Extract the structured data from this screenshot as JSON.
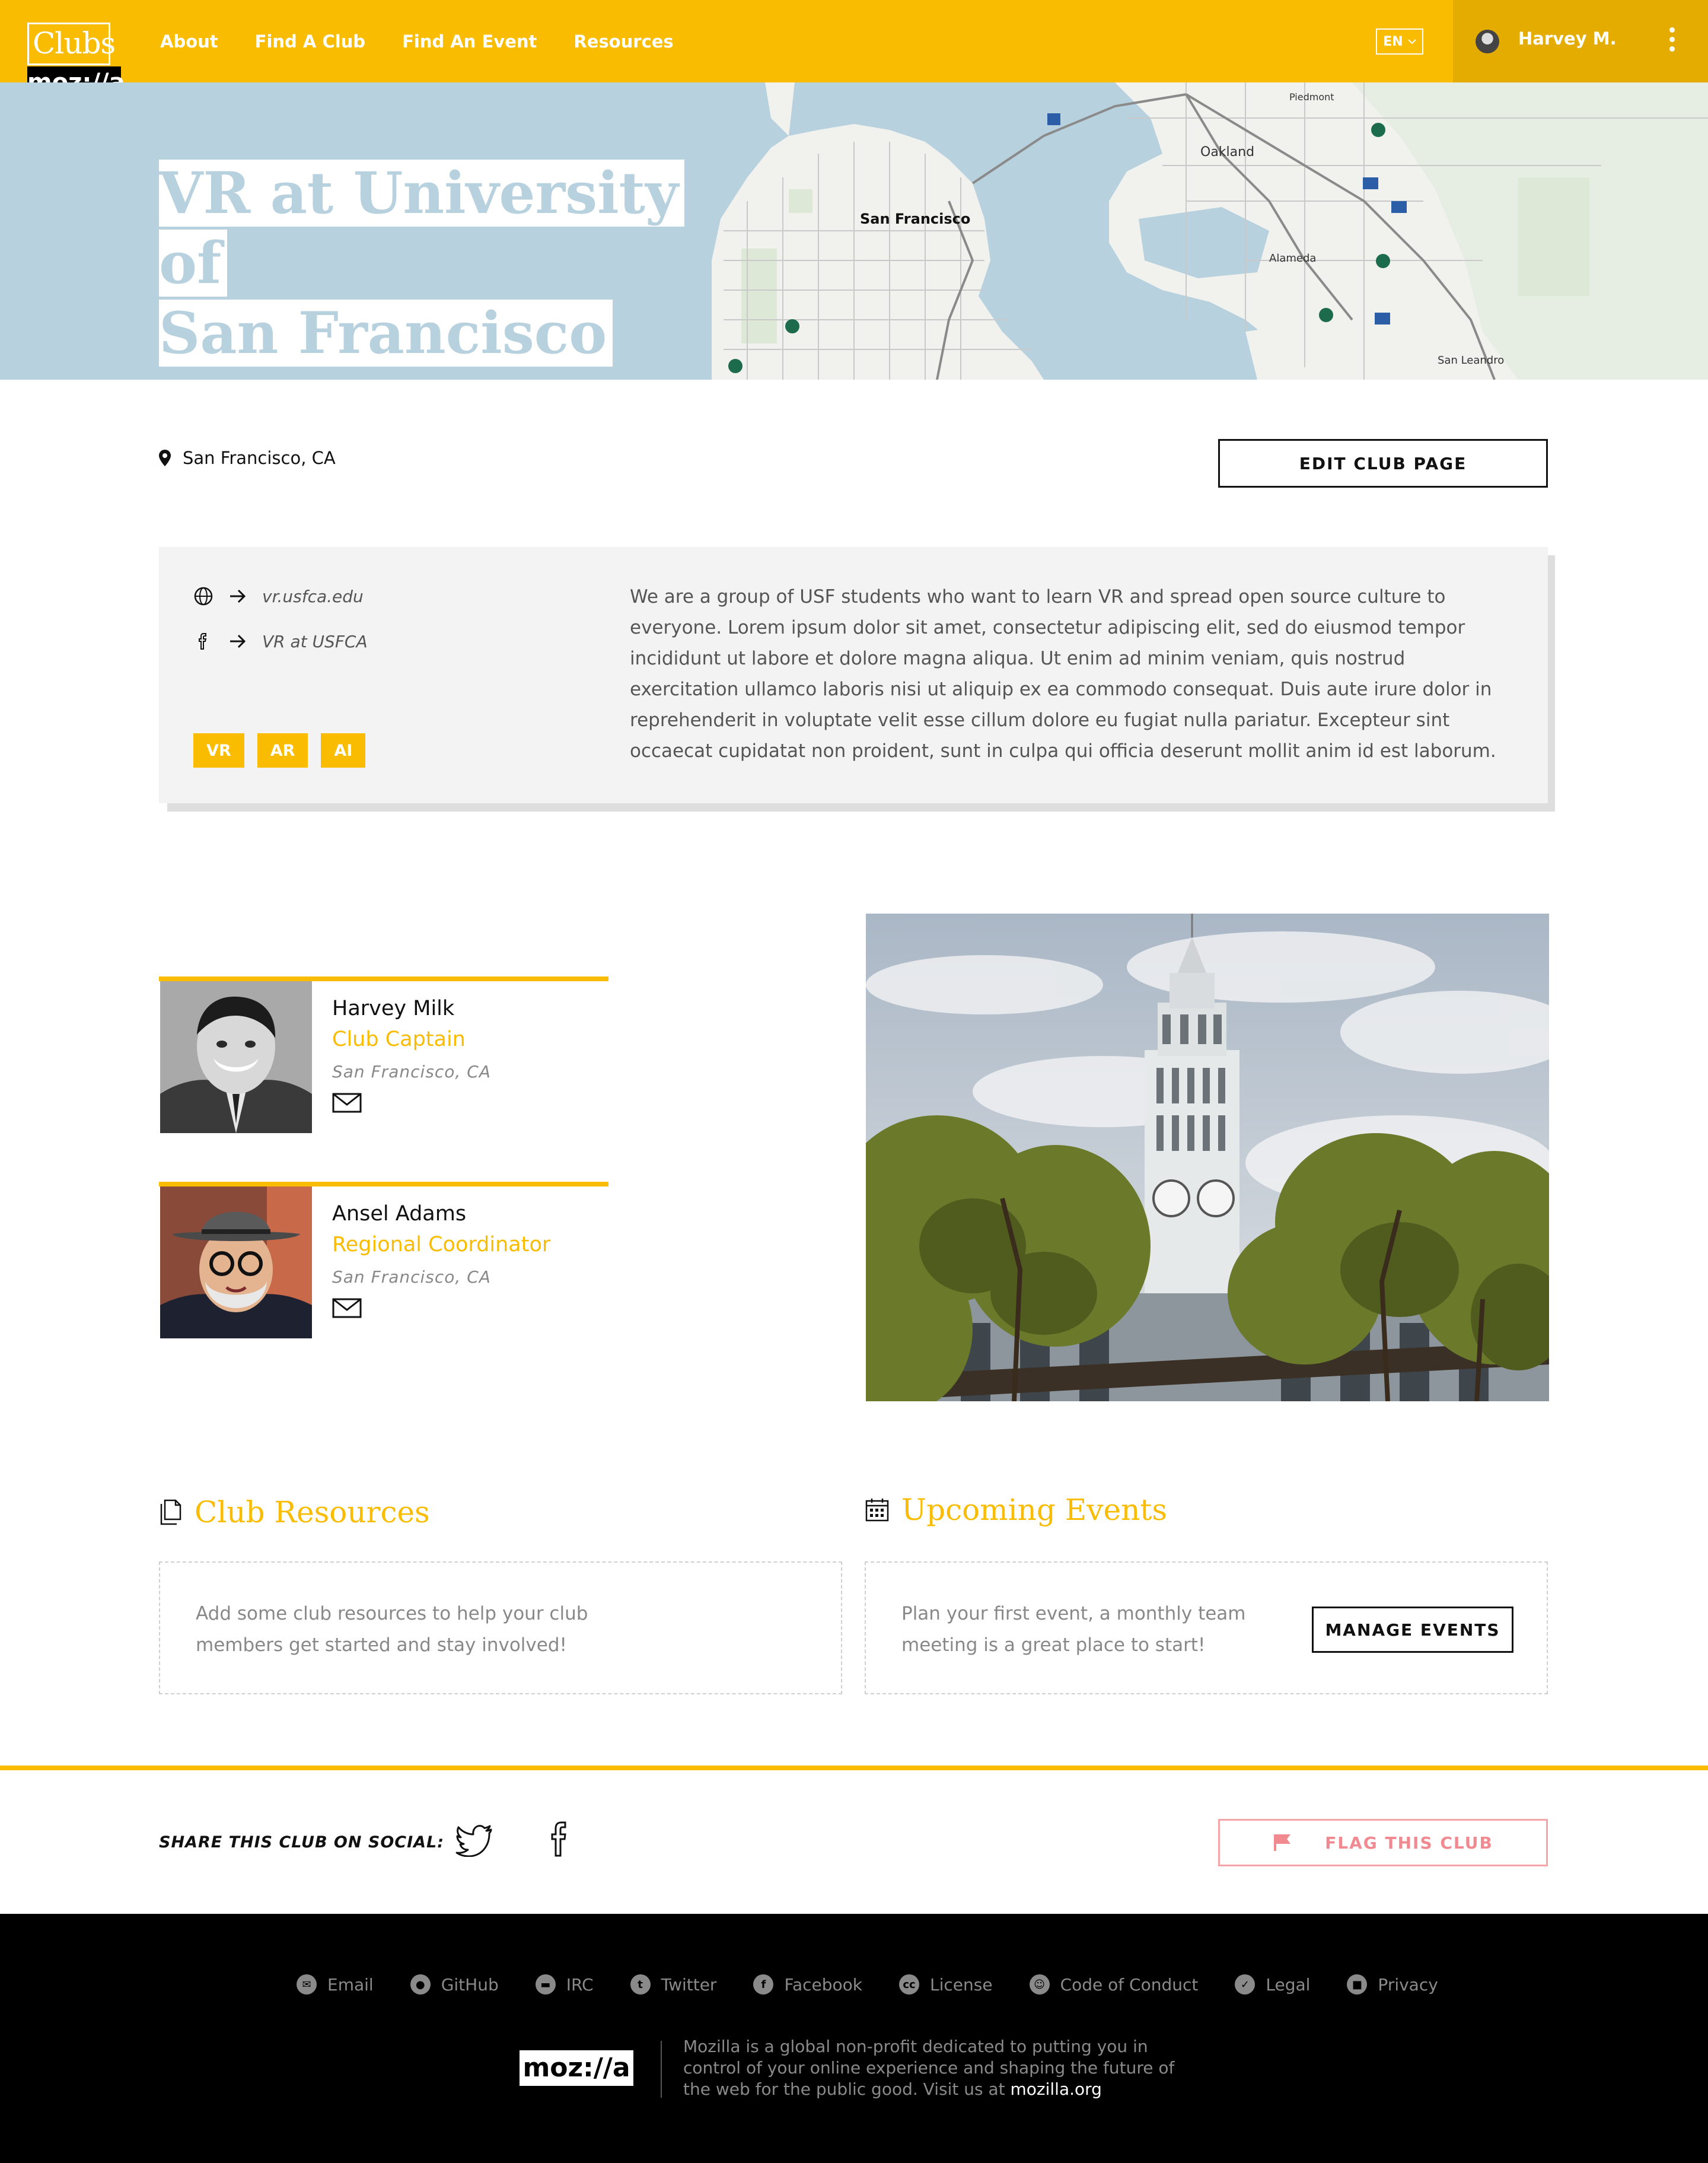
{
  "header": {
    "logo_clubs": "Clubs",
    "logo_mozilla": "moz://a",
    "nav": [
      {
        "label": "About"
      },
      {
        "label": "Find A Club"
      },
      {
        "label": "Find An Event"
      },
      {
        "label": "Resources"
      }
    ],
    "language": "EN",
    "user_name": "Harvey M."
  },
  "hero": {
    "title_line1": "VR at University of",
    "title_line2": "San Francisco",
    "map_labels": [
      "San Francisco",
      "Oakland",
      "Alameda",
      "Piedmont",
      "San Leandro"
    ]
  },
  "club": {
    "location": "San Francisco, CA",
    "edit_label": "EDIT CLUB PAGE",
    "website": "vr.usfca.edu",
    "facebook": "VR at USFCA",
    "tags": [
      "VR",
      "AR",
      "AI"
    ],
    "description": "We are a group of USF students who want to learn VR and spread open source culture to everyone. Lorem ipsum dolor sit amet, consectetur adipiscing elit, sed do eiusmod tempor incididunt ut labore et dolore magna aliqua. Ut enim ad minim veniam, quis nostrud exercitation ullamco laboris nisi ut aliquip ex ea commodo consequat. Duis aute irure dolor in reprehenderit in voluptate velit esse cillum dolore eu fugiat nulla pariatur. Excepteur sint occaecat cupidatat non proident, sunt in culpa qui officia deserunt mollit anim id est laborum."
  },
  "leaders": [
    {
      "name": "Harvey Milk",
      "role": "Club Captain",
      "location": "San Francisco, CA"
    },
    {
      "name": "Ansel Adams",
      "role": "Regional Coordinator",
      "location": "San Francisco, CA"
    }
  ],
  "resources": {
    "title": "Club Resources",
    "empty_text": "Add some club resources to help your club members get started and stay involved!"
  },
  "events": {
    "title": "Upcoming Events",
    "empty_text": "Plan your first event, a monthly team meeting is a great place to start!",
    "manage_label": "MANAGE EVENTS"
  },
  "share": {
    "label": "SHARE THIS CLUB ON SOCIAL:",
    "flag_label": "FLAG THIS CLUB"
  },
  "footer": {
    "links": [
      {
        "label": "Email",
        "icon": "email-icon"
      },
      {
        "label": "GitHub",
        "icon": "github-icon"
      },
      {
        "label": "IRC",
        "icon": "irc-icon"
      },
      {
        "label": "Twitter",
        "icon": "twitter-icon"
      },
      {
        "label": "Facebook",
        "icon": "facebook-icon"
      },
      {
        "label": "License",
        "icon": "license-icon"
      },
      {
        "label": "Code of Conduct",
        "icon": "smiley-icon"
      },
      {
        "label": "Legal",
        "icon": "check-icon"
      },
      {
        "label": "Privacy",
        "icon": "lock-icon"
      }
    ],
    "logo": "moz://a",
    "about_text": "Mozilla is a global non-profit dedicated to putting you in control of your online experience and shaping the future of the web for the public good. Visit us at",
    "about_link": "mozilla.org"
  },
  "colors": {
    "accent": "#f9bc00",
    "flag": "#f08a90",
    "map_water": "#b8d1de"
  }
}
